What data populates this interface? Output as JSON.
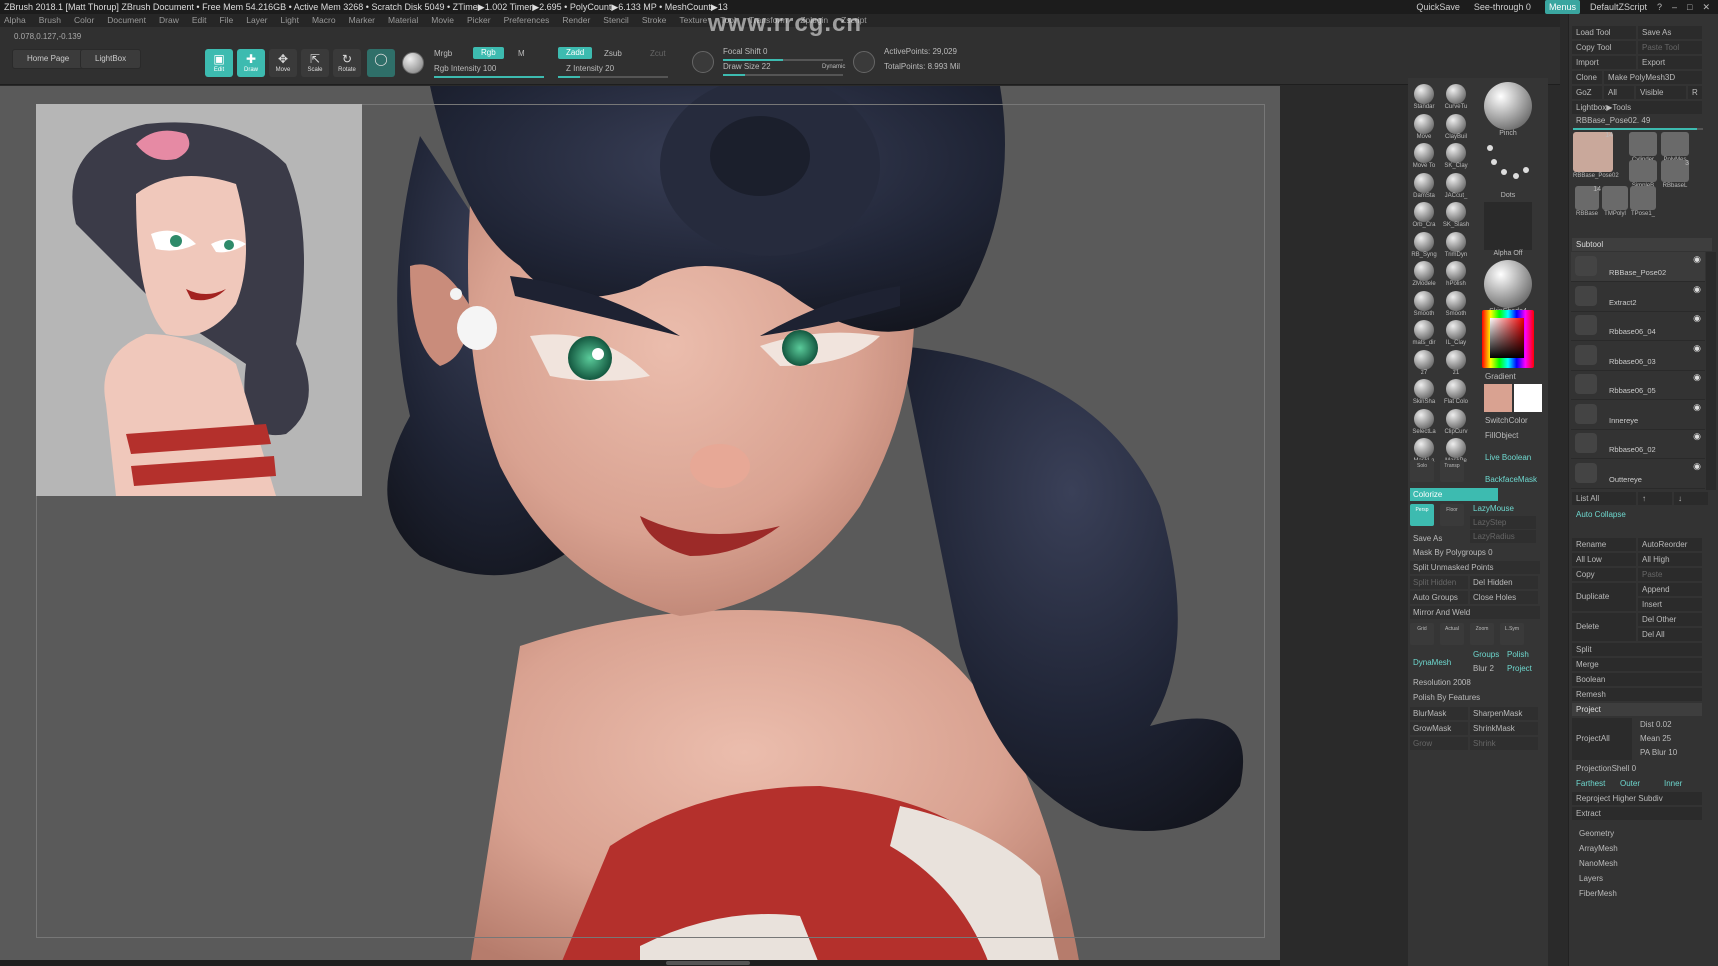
{
  "titlebar": {
    "text": "ZBrush 2018.1 [Matt Thorup]   ZBrush Document     • Free Mem 54.216GB • Active Mem 3268 • Scratch Disk 5049 • ZTime▶1.002 Timer▶2.695 • PolyCount▶6.133 MP • MeshCount▶13",
    "quicksave": "QuickSave",
    "seethrough": "See-through  0",
    "menus": "Menus",
    "script": "DefaultZScript"
  },
  "menubar": [
    "Alpha",
    "Brush",
    "Color",
    "Document",
    "Draw",
    "Edit",
    "File",
    "Layer",
    "Light",
    "Macro",
    "Marker",
    "Material",
    "Movie",
    "Picker",
    "Preferences",
    "Render",
    "Stencil",
    "Stroke",
    "Texture",
    "Tool",
    "Transform",
    "Zplugin",
    "Zscript"
  ],
  "watermark": "www.rrcg.cn",
  "toolbar": {
    "coords": "0.078,0.127,-0.139",
    "home": "Home Page",
    "lightbox": "LightBox",
    "edit": "Edit",
    "draw": "Draw",
    "move": "Move",
    "scale": "Scale",
    "rotate": "Rotate",
    "mrgb": "Mrgb",
    "rgb": "Rgb",
    "m": "M",
    "rgb_intensity": "Rgb Intensity 100",
    "zadd": "Zadd",
    "zsub": "Zsub",
    "zcut": "Zcut",
    "z_intensity": "Z Intensity 20",
    "focal_shift": "Focal Shift 0",
    "draw_size": "Draw Size 22",
    "dynamic": "Dynamic",
    "active_points": "ActivePoints: 29,029",
    "total_points": "TotalPoints: 8.993 Mil"
  },
  "brushes": [
    {
      "id": "standard",
      "label": "Standar"
    },
    {
      "id": "curve",
      "label": "CurveTu"
    },
    {
      "id": "move",
      "label": "Move"
    },
    {
      "id": "claybuild",
      "label": "ClayBuil"
    },
    {
      "id": "movetop",
      "label": "Move To"
    },
    {
      "id": "skclay",
      "label": "SK_Clay"
    },
    {
      "id": "damstd",
      "label": "DamSta"
    },
    {
      "id": "jaccut",
      "label": "JACcut_"
    },
    {
      "id": "orbcrack",
      "label": "Orb_Cra"
    },
    {
      "id": "skslash",
      "label": "SK_Slash"
    },
    {
      "id": "rbsyng",
      "label": "RB_Syng"
    },
    {
      "id": "trimdyn",
      "label": "TrimDyn"
    },
    {
      "id": "zmodeler",
      "label": "ZModele"
    },
    {
      "id": "hpolish",
      "label": "hPolish"
    },
    {
      "id": "smooth",
      "label": "Smooth"
    },
    {
      "id": "smooth2",
      "label": "Smooth"
    },
    {
      "id": "matsdir",
      "label": "mats_dir"
    },
    {
      "id": "ilclay",
      "label": "IL_Clay"
    },
    {
      "id": "z7",
      "label": "z7"
    },
    {
      "id": "z1",
      "label": "z1"
    },
    {
      "id": "skinshade",
      "label": "SkinSha"
    },
    {
      "id": "flatcolor",
      "label": "Flat Colo"
    },
    {
      "id": "selectlasso",
      "label": "SelectLa"
    },
    {
      "id": "clipcurve",
      "label": "ClipCurv"
    },
    {
      "id": "masklasso",
      "label": "MaskLa"
    },
    {
      "id": "maskpen",
      "label": "MaskPe"
    }
  ],
  "previews": {
    "pinch": "Pinch",
    "dots": "Dots",
    "alpha": "Alpha Off",
    "skinshade4": "SkinShade4",
    "gradient": "Gradient",
    "switchcolor": "SwitchColor",
    "fillobject": "FillObject",
    "liveboolean": "Live Boolean",
    "backfacemask": "BackfaceMask"
  },
  "midpanel": {
    "colorize": "Colorize",
    "lazymouse": "LazyMouse",
    "lazystep": "LazyStep",
    "lazyradius": "LazyRadius",
    "saveas": "Save As",
    "maskbypoly": "Mask By Polygroups 0",
    "splitunmasked": "Split Unmasked Points",
    "splithidden": "Split Hidden",
    "delhidden": "Del Hidden",
    "autogroups": "Auto Groups",
    "closeholes": "Close Holes",
    "mirrorweld": "Mirror And Weld",
    "dynamesh": "DynaMesh",
    "groups": "Groups",
    "polish": "Polish",
    "blur": "Blur 2",
    "project": "Project",
    "resolution": "Resolution 2008",
    "polishfeatures": "Polish By Features",
    "blurmask": "BlurMask",
    "sharpenmask": "SharpenMask",
    "growmask": "GrowMask",
    "shrinkmask": "ShrinkMask",
    "grow": "Grow",
    "shrink": "Shrink",
    "persp": "Persp",
    "floor": "Floor",
    "solo": "Solo",
    "transp": "Transp",
    "grid": "Grid",
    "actual": "Actual",
    "zoom": "Zoom",
    "lsym": "L.Sym"
  },
  "toolpanel": {
    "loadtool": "Load Tool",
    "saveas": "Save As",
    "copytool": "Copy Tool",
    "pastetool": "Paste Tool",
    "import": "Import",
    "export": "Export",
    "clone": "Clone",
    "makepoly": "Make PolyMesh3D",
    "goz": "GoZ",
    "all": "All",
    "visible": "Visible",
    "r": "R",
    "lightboxtools": "Lightbox▶Tools",
    "currenttool": "RBBase_Pose02. 49",
    "thumbs": [
      {
        "label": "RBBase_Pose02",
        "n": "14"
      },
      {
        "label": "Cylinder",
        "n": ""
      },
      {
        "label": "PolyMes",
        "n": ""
      },
      {
        "label": "SimpleB",
        "n": ""
      },
      {
        "label": "RBbaseL",
        "n": "3"
      },
      {
        "label": "RBBase",
        "n": "14"
      },
      {
        "label": "TMPolyl",
        "n": ""
      },
      {
        "label": "TPose1_",
        "n": ""
      }
    ],
    "subtool": "Subtool",
    "subtools": [
      "RBBase_Pose02",
      "Extract2",
      "Rbbase06_04",
      "Rbbase06_03",
      "Rbbase06_05",
      "Innereye",
      "Rbbase06_02",
      "Outtereye"
    ],
    "listall": "List All",
    "autocollapse": "Auto Collapse",
    "rename": "Rename",
    "autoreorder": "AutoReorder",
    "alllow": "All Low",
    "allhigh": "All High",
    "copy": "Copy",
    "paste": "Paste",
    "duplicate": "Duplicate",
    "append": "Append",
    "insert": "Insert",
    "delete": "Delete",
    "delother": "Del Other",
    "delall": "Del All",
    "split": "Split",
    "merge": "Merge",
    "boolean": "Boolean",
    "remesh": "Remesh",
    "projecthdr": "Project",
    "projectall": "ProjectAll",
    "dist": "Dist 0.02",
    "mean": "Mean 25",
    "pablur": "PA Blur 10",
    "projshell": "ProjectionShell 0",
    "farthest": "Farthest",
    "outer": "Outer",
    "inner": "Inner",
    "reproject": "Reproject Higher Subdiv",
    "extract": "Extract",
    "geometry": "Geometry",
    "arraymesh": "ArrayMesh",
    "nanomesh": "NanoMesh",
    "layers": "Layers",
    "fibermesh": "FiberMesh"
  },
  "colors": {
    "accent": "#3dbbb0",
    "hair": "#1d2233",
    "skin": "#d9a291",
    "lips": "#9c2a28",
    "shirt_red": "#b4302c",
    "shirt_white": "#e9e2dc",
    "viewport_bg": "#5a5a5a"
  }
}
